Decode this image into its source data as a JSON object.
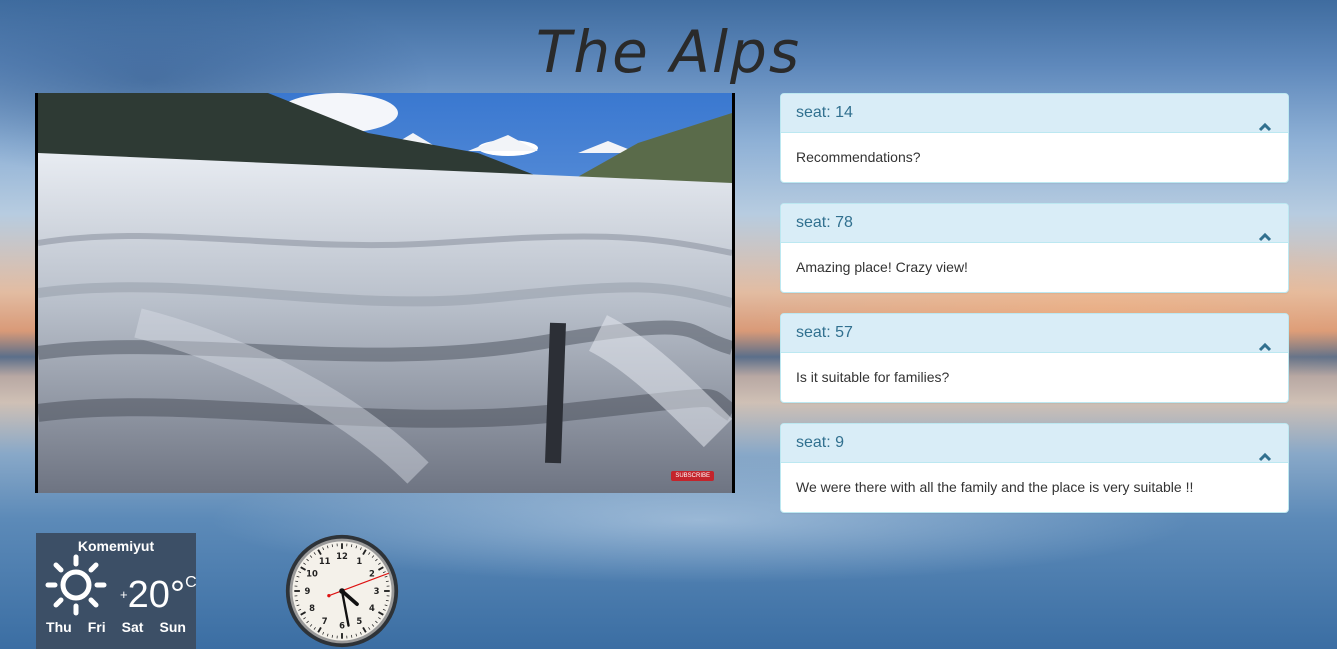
{
  "page": {
    "title": "The Alps"
  },
  "video": {
    "badge": "SUBSCRIBE"
  },
  "comments": [
    {
      "seat": "seat: 14",
      "text": "Recommendations?"
    },
    {
      "seat": "seat: 78",
      "text": "Amazing place! Crazy view!"
    },
    {
      "seat": "seat: 57",
      "text": "Is it suitable for families?"
    },
    {
      "seat": "seat: 9",
      "text": "We were there with all the family and the place is very suitable !!"
    }
  ],
  "weather": {
    "city": "Komemiyut",
    "temp_sign": "+",
    "temp": "20°",
    "unit": "C",
    "icon": "sun-icon",
    "days": [
      "Thu",
      "Fri",
      "Sat",
      "Sun"
    ]
  },
  "clock": {
    "numerals": [
      "12",
      "1",
      "2",
      "3",
      "4",
      "5",
      "6",
      "7",
      "8",
      "9",
      "10",
      "11"
    ]
  },
  "colors": {
    "panel_heading_bg": "#d9edf7",
    "panel_heading_text": "#31708f",
    "panel_border": "#bce8f1",
    "weather_bg": "#3c4f66"
  }
}
